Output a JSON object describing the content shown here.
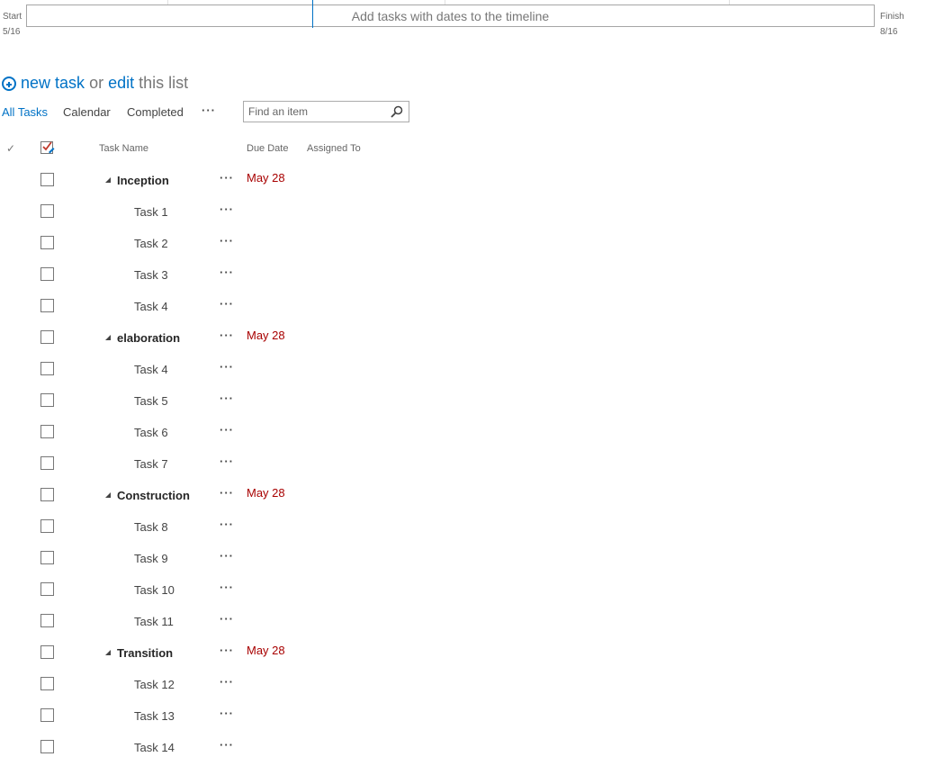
{
  "timeline": {
    "start_label": "Start",
    "start_date": "5/16",
    "finish_label": "Finish",
    "finish_date": "8/16",
    "placeholder": "Add tasks with dates to the timeline"
  },
  "new_task": {
    "new_task_label": "new task",
    "or_label": "or",
    "edit_label": "edit",
    "this_list_label": "this list"
  },
  "views": {
    "all_tasks": "All Tasks",
    "calendar": "Calendar",
    "completed": "Completed",
    "more": "···"
  },
  "search": {
    "placeholder": "Find an item"
  },
  "columns": {
    "check": "✓",
    "task_name": "Task Name",
    "due_date": "Due Date",
    "assigned_to": "Assigned To"
  },
  "rows": [
    {
      "name": "Inception",
      "group": true,
      "due": "May 28"
    },
    {
      "name": "Task 1",
      "group": false,
      "due": ""
    },
    {
      "name": "Task 2",
      "group": false,
      "due": ""
    },
    {
      "name": "Task 3",
      "group": false,
      "due": ""
    },
    {
      "name": "Task 4",
      "group": false,
      "due": ""
    },
    {
      "name": "elaboration",
      "group": true,
      "due": "May 28"
    },
    {
      "name": "Task 4",
      "group": false,
      "due": ""
    },
    {
      "name": "Task 5",
      "group": false,
      "due": ""
    },
    {
      "name": "Task 6",
      "group": false,
      "due": ""
    },
    {
      "name": "Task 7",
      "group": false,
      "due": ""
    },
    {
      "name": "Construction",
      "group": true,
      "due": "May 28"
    },
    {
      "name": "Task 8",
      "group": false,
      "due": ""
    },
    {
      "name": "Task 9",
      "group": false,
      "due": ""
    },
    {
      "name": "Task 10",
      "group": false,
      "due": ""
    },
    {
      "name": "Task 11",
      "group": false,
      "due": ""
    },
    {
      "name": "Transition",
      "group": true,
      "due": "May 28"
    },
    {
      "name": "Task 12",
      "group": false,
      "due": ""
    },
    {
      "name": "Task 13",
      "group": false,
      "due": ""
    },
    {
      "name": "Task 14",
      "group": false,
      "due": ""
    }
  ],
  "row_more_label": "···",
  "colors": {
    "accent": "#0072c6",
    "due_date": "#a80000",
    "edit_checkbox_accent": "#c0392b"
  },
  "icons": {
    "new_task": "plus-circle-icon",
    "search": "magnifier-icon",
    "group_toggle": "triangle-collapse-icon",
    "edit_list": "checkbox-edit-icon"
  }
}
